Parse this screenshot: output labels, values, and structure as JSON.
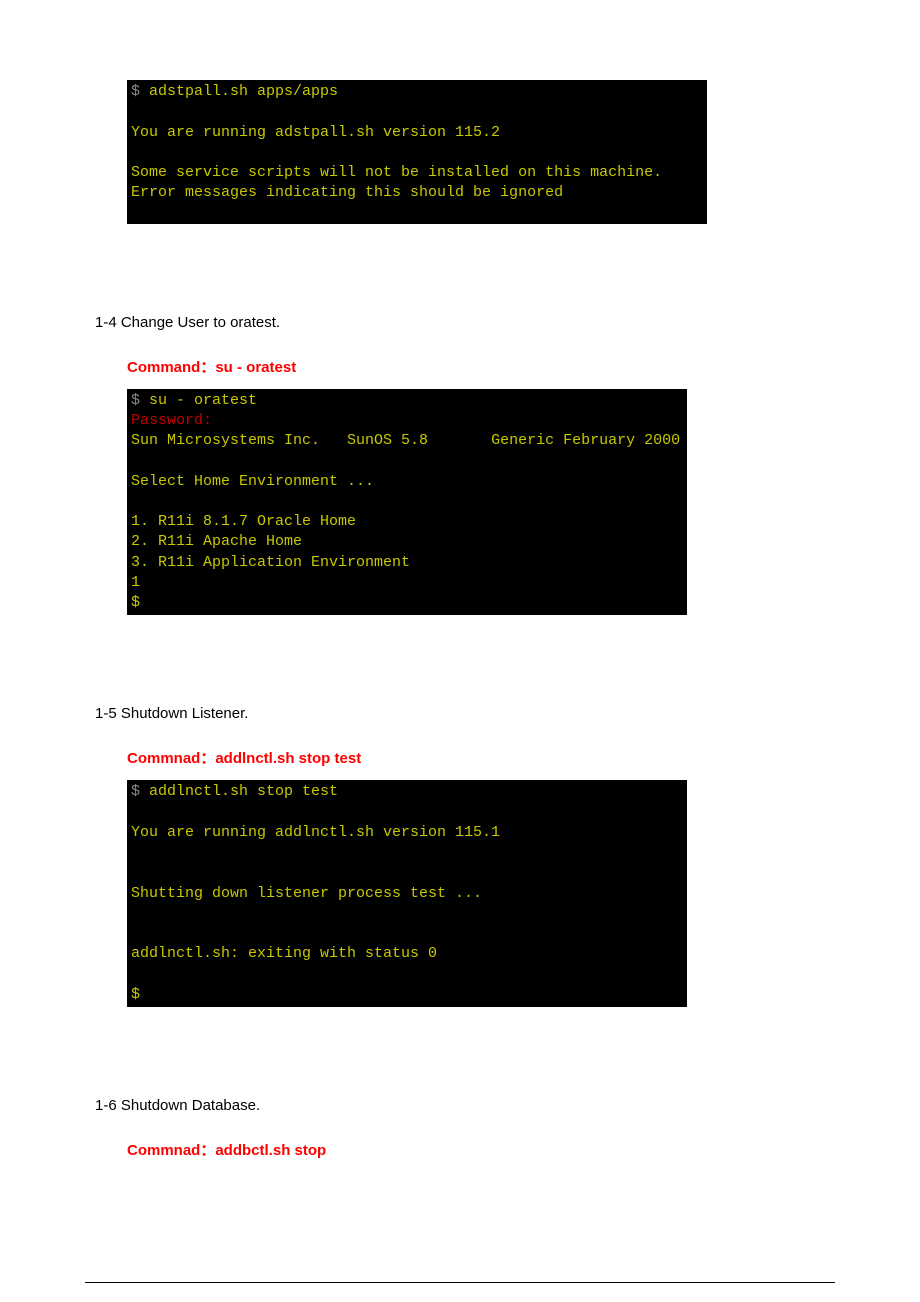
{
  "terminal1": {
    "line1_prompt": "$",
    "line1_cmd": " adstpall.sh apps/apps",
    "line2": "",
    "line3": "You are running adstpall.sh version 115.2",
    "line4": "",
    "line5": "Some service scripts will not be installed on this machine.",
    "line6": "Error messages indicating this should be ignored"
  },
  "step14": {
    "heading": "1-4  Change User to oratest.",
    "command_label": "Command：",
    "command_text": "su - oratest"
  },
  "terminal2": {
    "line1_prompt": "$",
    "line1_cmd": " su - oratest",
    "line2_label": "Password:",
    "line3a": "Sun Microsystems Inc.   SunOS 5.8",
    "line3b": "       Generic February 2000",
    "line4": "",
    "line5": "Select Home Environment ...",
    "line6": "",
    "line7": "1. R11i 8.1.7 Oracle Home",
    "line8": "2. R11i Apache Home",
    "line9": "3. R11i Application Environment",
    "line10": "1",
    "line11": "$"
  },
  "step15": {
    "heading": "1-5  Shutdown Listener.",
    "command_label": "Commnad：",
    "command_text": "addlnctl.sh stop test"
  },
  "terminal3": {
    "line1_prompt": "$",
    "line1_cmd": " addlnctl.sh stop test",
    "line2": "",
    "line3": "You are running addlnctl.sh version 115.1",
    "line4": "",
    "line5": "",
    "line6": "Shutting down listener process test ...",
    "line7": "",
    "line8": "",
    "line9": "addlnctl.sh: exiting with status 0",
    "line10": "",
    "line11": "$"
  },
  "step16": {
    "heading": "1-6  Shutdown Database.",
    "command_label": "Commnad：",
    "command_text": "addbctl.sh stop"
  }
}
